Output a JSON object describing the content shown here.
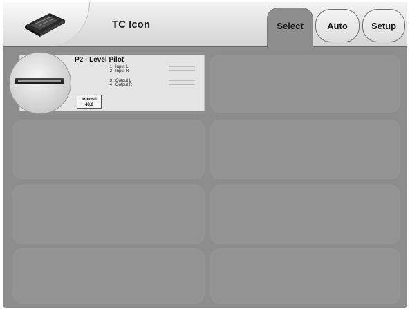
{
  "header": {
    "title": "TC Icon",
    "logo_icon": "mixer-device-icon"
  },
  "tabs": [
    {
      "label": "Select",
      "selected": true
    },
    {
      "label": "Auto",
      "selected": false
    },
    {
      "label": "Setup",
      "selected": false
    }
  ],
  "device": {
    "name": "P2 - Level Pilot",
    "inputs": [
      {
        "num": "1",
        "label": "Input L"
      },
      {
        "num": "2",
        "label": "Input R"
      }
    ],
    "outputs": [
      {
        "num": "3",
        "label": "Output L"
      },
      {
        "num": "4",
        "label": "Output R"
      }
    ],
    "clock_label": "Internal",
    "clock_rate": "48.0"
  },
  "colors": {
    "background": "#8d8d8d",
    "card": "#e4e4e4",
    "header": "#e6e6e6"
  }
}
